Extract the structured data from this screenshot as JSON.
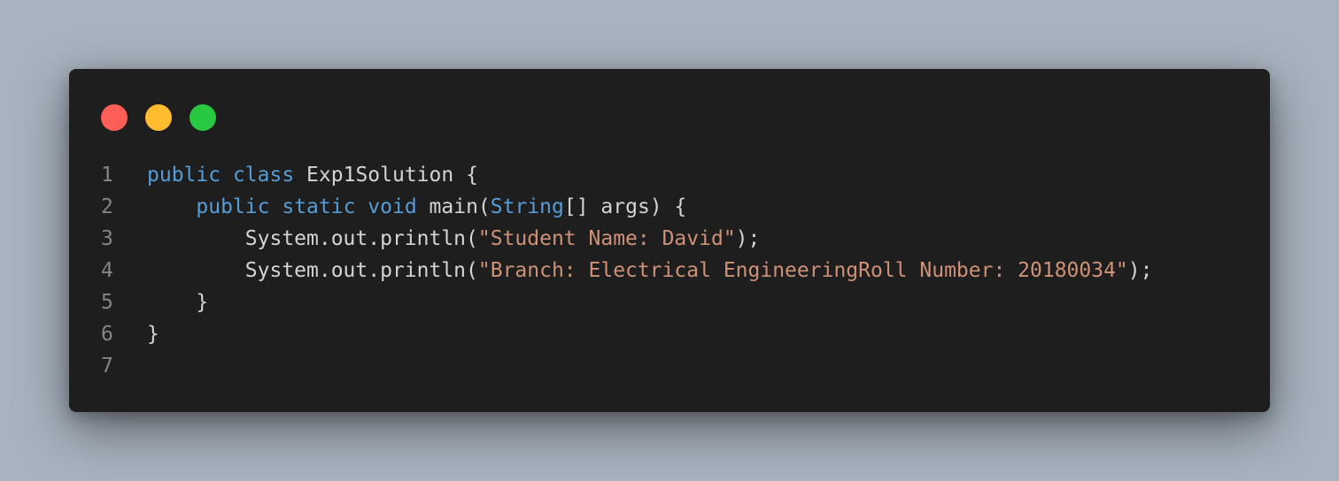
{
  "window_controls": {
    "close_color": "#ff5f57",
    "minimize_color": "#febc2e",
    "maximize_color": "#28c840"
  },
  "colors": {
    "background": "#a9b3bf",
    "editor_bg": "#1e1e1e",
    "keyword": "#569cd6",
    "string": "#ce9178",
    "text": "#d4d4d4",
    "line_number": "#858585"
  },
  "code": {
    "lines": [
      {
        "number": "1",
        "tokens": [
          {
            "text": "public",
            "kind": "kw"
          },
          {
            "text": " ",
            "kind": "plain"
          },
          {
            "text": "class",
            "kind": "kw"
          },
          {
            "text": " Exp1Solution {",
            "kind": "plain"
          }
        ]
      },
      {
        "number": "2",
        "tokens": [
          {
            "text": "    ",
            "kind": "plain"
          },
          {
            "text": "public",
            "kind": "kw"
          },
          {
            "text": " ",
            "kind": "plain"
          },
          {
            "text": "static",
            "kind": "kw"
          },
          {
            "text": " ",
            "kind": "plain"
          },
          {
            "text": "void",
            "kind": "kw"
          },
          {
            "text": " main(",
            "kind": "plain"
          },
          {
            "text": "String",
            "kind": "kw"
          },
          {
            "text": "[] args) {",
            "kind": "plain"
          }
        ]
      },
      {
        "number": "3",
        "tokens": [
          {
            "text": "        System.out.println(",
            "kind": "plain"
          },
          {
            "text": "\"Student Name: David\"",
            "kind": "str"
          },
          {
            "text": ");",
            "kind": "plain"
          }
        ]
      },
      {
        "number": "4",
        "tokens": [
          {
            "text": "        System.out.println(",
            "kind": "plain"
          },
          {
            "text": "\"Branch: Electrical EngineeringRoll Number: 20180034\"",
            "kind": "str"
          },
          {
            "text": ");",
            "kind": "plain"
          }
        ]
      },
      {
        "number": "5",
        "tokens": [
          {
            "text": "    }",
            "kind": "plain"
          }
        ]
      },
      {
        "number": "6",
        "tokens": [
          {
            "text": "}",
            "kind": "plain"
          }
        ]
      },
      {
        "number": "7",
        "tokens": []
      }
    ]
  }
}
